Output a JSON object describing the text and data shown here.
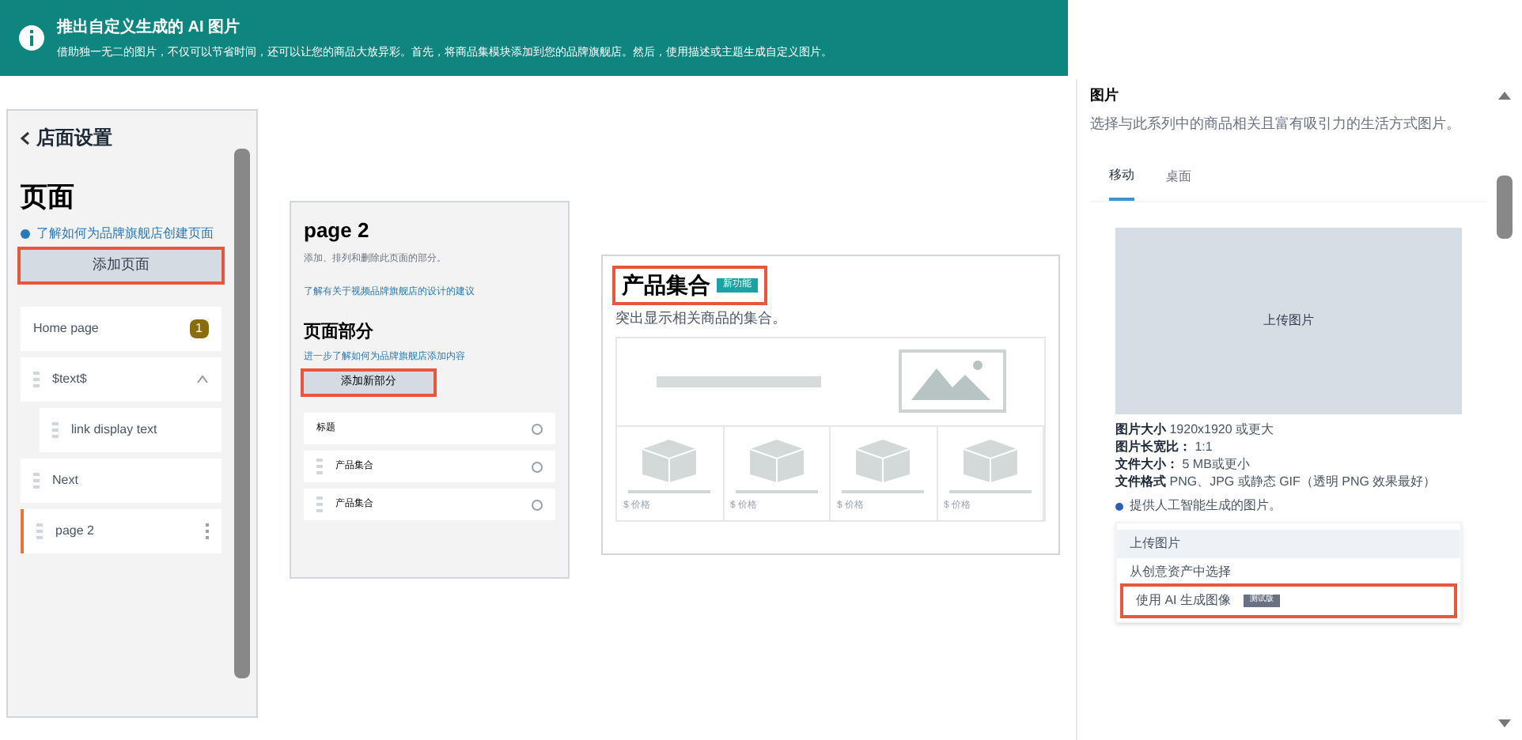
{
  "banner": {
    "title": "推出自定义生成的 AI 图片",
    "text": "借助独一无二的图片，不仅可以节省时间，还可以让您的商品大放异彩。首先，将商品集模块添加到您的品牌旗舰店。然后，使用描述或主题生成自定义图片。"
  },
  "pages_panel": {
    "back": "店面设置",
    "title": "页面",
    "help_link": "了解如何为品牌旗舰店创建页面",
    "add_button": "添加页面",
    "pages": [
      {
        "label": "Home page",
        "badge": "1",
        "selected": false
      },
      {
        "label": "$text$",
        "selected": false,
        "expanded": true,
        "children": [
          {
            "label": "link display text",
            "selected": false
          }
        ]
      },
      {
        "label": "Next",
        "selected": false
      },
      {
        "label": "page 2",
        "selected": true
      }
    ]
  },
  "page_panel": {
    "title": "page 2",
    "subtitle": "添加、排列和删除此页面的部分。",
    "tip_link": "了解有关于视频品牌旗舰店的设计的建议",
    "section_title": "页面部分",
    "help_link": "进一步了解如何为品牌旗舰店添加内容",
    "add_button": "添加新部分",
    "sections": [
      {
        "label": "标题",
        "draggable": false
      },
      {
        "label": "产品集合",
        "draggable": true
      },
      {
        "label": "产品集合",
        "draggable": true
      }
    ]
  },
  "module": {
    "title": "产品集合",
    "badge": "新功能",
    "description": "突出显示相关商品的集合。",
    "products": [
      "$ 价格",
      "$ 价格",
      "$ 价格",
      "$ 价格"
    ]
  },
  "image_panel": {
    "title": "图片",
    "description": "选择与此系列中的商品相关且富有吸引力的生活方式图片。",
    "tabs": [
      {
        "label": "移动",
        "selected": true
      },
      {
        "label": "桌面",
        "selected": false
      }
    ],
    "upload_area": "上传图片",
    "specs": [
      {
        "label": "图片大小",
        "value": "1920x1920 或更大"
      },
      {
        "label": "图片长宽比：",
        "value": "1:1"
      },
      {
        "label": "文件大小：",
        "value": "5 MB或更小"
      },
      {
        "label": "文件格式",
        "value": "PNG、JPG 或静态 GIF（透明 PNG 效果最好）"
      }
    ],
    "ai_note": "提供人工智能生成的图片。",
    "menu": [
      {
        "label": "上传图片",
        "selected": true
      },
      {
        "label": "从创意资产中选择",
        "selected": false
      },
      {
        "label": "使用 AI 生成图像",
        "badge": "测试版",
        "selected": false
      }
    ]
  }
}
